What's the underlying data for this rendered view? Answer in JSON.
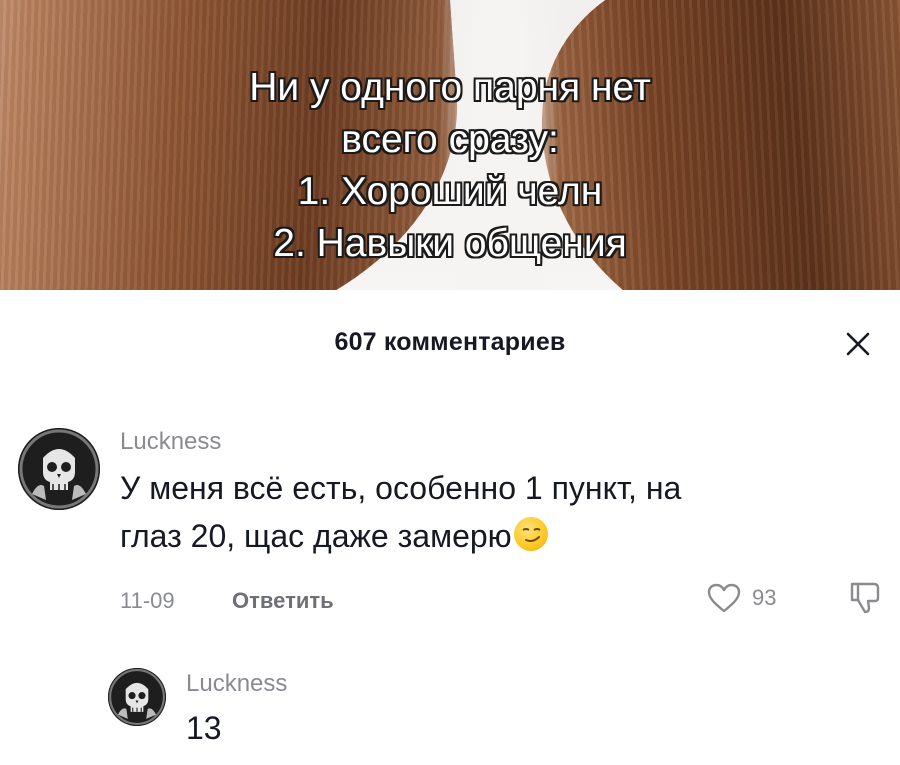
{
  "video": {
    "caption_lines": [
      "Ни у одного парня нет",
      "всего сразу:",
      "1. Хороший челн",
      "2. Навыки общения"
    ]
  },
  "comments_panel": {
    "title": "607 комментариев",
    "close_icon": "close-icon"
  },
  "comments": [
    {
      "username": "Luckness",
      "text_line1": "У меня всё есть, особенно 1 пункт, на",
      "text_line2": "глаз 20, щас даже замерю",
      "emoji": "smirking-face-emoji",
      "date": "11-09",
      "reply_label": "Ответить",
      "like_count": "93"
    },
    {
      "username": "Luckness",
      "text": "13"
    }
  ],
  "colors": {
    "primary_text": "#161823",
    "secondary_text": "#8a8b91",
    "background": "#ffffff"
  }
}
